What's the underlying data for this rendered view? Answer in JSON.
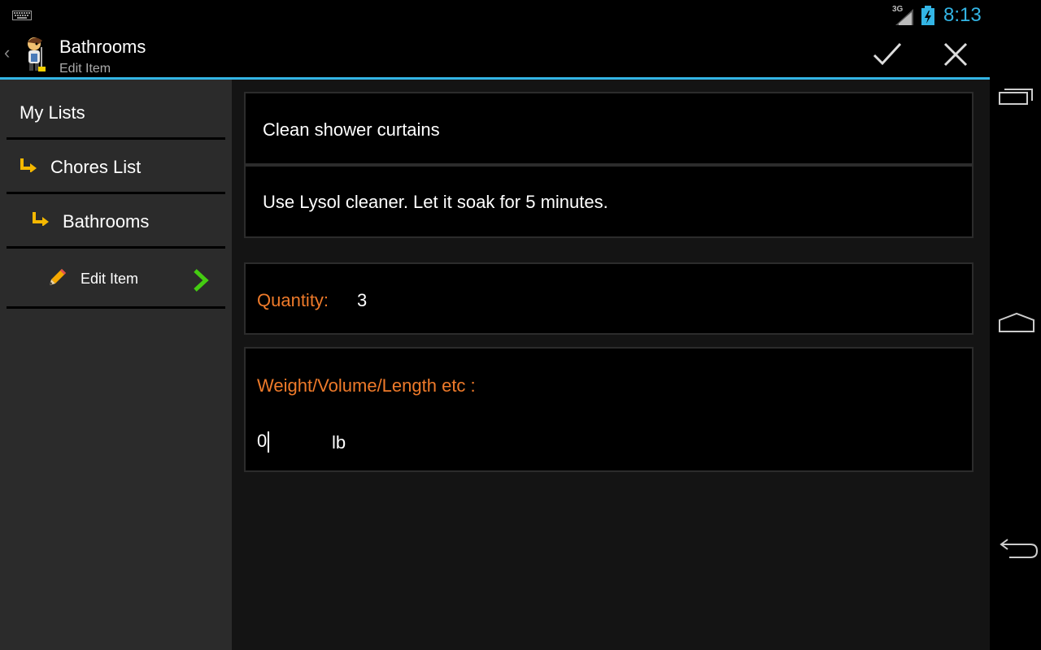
{
  "status_bar": {
    "network": "3G",
    "time": "8:13",
    "clock_color": "#33b5e5"
  },
  "action_bar": {
    "title": "Bathrooms",
    "subtitle": "Edit Item",
    "accent_color": "#33b5e5"
  },
  "sidebar": {
    "items": [
      {
        "label": "My Lists",
        "icon": null
      },
      {
        "label": "Chores List",
        "icon": "folder-arrow-icon"
      },
      {
        "label": "Bathrooms",
        "icon": "folder-arrow-icon"
      },
      {
        "label": "Edit Item",
        "icon": "pencil-icon",
        "trailing_icon": "chevron-right-icon"
      }
    ]
  },
  "form": {
    "item_name": "Clean shower curtains",
    "item_notes": "Use Lysol cleaner. Let it soak for 5 minutes.",
    "quantity_label": "Quantity:",
    "quantity_value": "3",
    "weight_label": "Weight/Volume/Length etc :",
    "weight_value": "0",
    "weight_unit": "lb",
    "label_color": "#ee7a2a"
  }
}
